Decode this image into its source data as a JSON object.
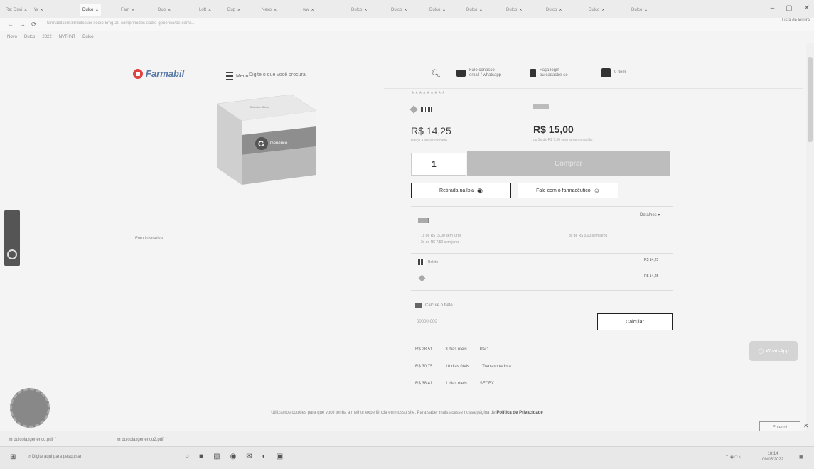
{
  "browser": {
    "tabs": [
      {
        "label": "Re: Dúvi",
        "active": false
      },
      {
        "label": "W",
        "active": false
      },
      {
        "label": "Dulco",
        "active": true
      },
      {
        "label": "Fam",
        "active": false
      },
      {
        "label": "Dup",
        "active": false
      },
      {
        "label": "Loft",
        "active": false
      },
      {
        "label": "Dup",
        "active": false
      },
      {
        "label": "Nexo",
        "active": false
      },
      {
        "label": "ww",
        "active": false
      },
      {
        "label": "Dulco",
        "active": false
      },
      {
        "label": "Dulco",
        "active": false
      },
      {
        "label": "Dulco",
        "active": false
      },
      {
        "label": "Dulco",
        "active": false
      },
      {
        "label": "Dulco",
        "active": false
      },
      {
        "label": "Dulco",
        "active": false
      },
      {
        "label": "Dulco",
        "active": false
      },
      {
        "label": "Dulco",
        "active": false
      }
    ],
    "url": "farmabilcom.br/dulcolax-sodio-5mg-20-comprimidos-sodio-generico/ps-com/...",
    "reading_list": "Lista de leitura",
    "bookmarks": [
      "Novo",
      "Dulco",
      "2022",
      "NVT-INT",
      "Dulco"
    ]
  },
  "header": {
    "logo": "Farmabil",
    "menu_label": "Menu",
    "search_placeholder": "Digite o que você procura",
    "contact": "Fale conosco",
    "contact_sub": "email / whatsapp",
    "login": "Faça login",
    "login_sub": "ou cadastre-se",
    "cart": "0 item"
  },
  "product": {
    "box_text_top": "Dulcolax Sódio",
    "box_brand": "Genérico",
    "caption": "Foto ilustrativa"
  },
  "pricing": {
    "price_left": "R$ 14,25",
    "price_left_note": "Preço a vista no boleto",
    "price_right": "R$ 15,00",
    "price_right_note": "ou 2x de R$ 7,50 sem juros no cartão",
    "quantity": "1",
    "buy": "Comprar",
    "pickup": "Retirada na loja",
    "pharmacist": "Fale com o farmacêutico"
  },
  "payment": {
    "details_label": "Detalhes",
    "boleto_price": "R$ 14,25",
    "pix_price": "R$ 14,25",
    "cep_label": "Calcule o frete",
    "cep_placeholder": "00000-000",
    "calc_button": "Calcular"
  },
  "shipping": [
    {
      "price": "R$ 28,51",
      "days": "3 dias úteis",
      "carrier": "PAC"
    },
    {
      "price": "R$ 30,75",
      "days": "10 dias úteis",
      "carrier": "Transportadora"
    },
    {
      "price": "R$ 38,41",
      "days": "1 dias úteis",
      "carrier": "SEDEX"
    }
  ],
  "whatsapp": "WhatsApp",
  "cookie": {
    "text": "Utilizamos cookies para que você tenha a melhor experiência em nosso site. Para saber mais acesse nossa página de",
    "link": "Política de Privacidade",
    "accept": "Entendi"
  },
  "downloads": {
    "item1": "dulcolaxgenerico.pdf",
    "item2": "dulcolaxgenerico2.pdf"
  },
  "taskbar": {
    "search": "Digite aqui para pesquisar",
    "time": "18:14",
    "date": "06/05/2022"
  }
}
